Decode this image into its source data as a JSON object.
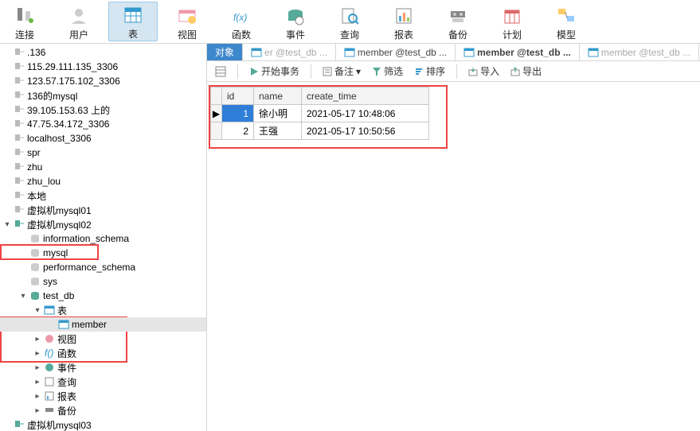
{
  "toolbar": [
    {
      "label": "连接",
      "name": "connection",
      "active": false
    },
    {
      "label": "用户",
      "name": "user",
      "active": false
    },
    {
      "label": "表",
      "name": "table",
      "active": true
    },
    {
      "label": "视图",
      "name": "view",
      "active": false
    },
    {
      "label": "函数",
      "name": "function",
      "active": false
    },
    {
      "label": "事件",
      "name": "event",
      "active": false
    },
    {
      "label": "查询",
      "name": "query",
      "active": false
    },
    {
      "label": "报表",
      "name": "report",
      "active": false
    },
    {
      "label": "备份",
      "name": "backup",
      "active": false
    },
    {
      "label": "计划",
      "name": "schedule",
      "active": false
    },
    {
      "label": "模型",
      "name": "model",
      "active": false
    }
  ],
  "tree": {
    "connections": [
      ".136",
      "115.29.111.135_3306",
      "123.57.175.102_3306",
      "136的mysql",
      "39.105.153.63 上的",
      "47.75.34.172_3306",
      "localhost_3306",
      "spr",
      "zhu",
      "zhu_lou",
      "本地",
      "虚拟机mysql01"
    ],
    "open_conn": "虚拟机mysql02",
    "schemas": [
      "information_schema",
      "mysql",
      "performance_schema",
      "sys"
    ],
    "open_db": "test_db",
    "db_nodes": {
      "tables_label": "表",
      "table_name": "member",
      "views": "视图",
      "funcs": "函数",
      "events": "事件",
      "queries": "查询",
      "reports": "报表",
      "backups": "备份"
    },
    "last_conn": "虚拟机mysql03"
  },
  "tabs": [
    {
      "label": "对象",
      "active": true,
      "muted": false
    },
    {
      "label": "er @test_db ...",
      "active": false,
      "muted": true
    },
    {
      "label": "member @test_db ...",
      "active": false,
      "muted": false
    },
    {
      "label": "member @test_db ...",
      "active": false,
      "muted": false,
      "bold": true
    },
    {
      "label": "member @test_db ...",
      "active": false,
      "muted": true
    }
  ],
  "subbar": {
    "begin_tx": "开始事务",
    "memo": "备注",
    "filter": "筛选",
    "sort": "排序",
    "import": "导入",
    "export": "导出"
  },
  "table": {
    "headers": [
      "id",
      "name",
      "create_time"
    ],
    "rows": [
      {
        "id": "1",
        "name": "徐小明",
        "time": "2021-05-17 10:48:06",
        "selected": true
      },
      {
        "id": "2",
        "name": "王强",
        "time": "2021-05-17 10:50:56",
        "selected": false
      }
    ]
  }
}
